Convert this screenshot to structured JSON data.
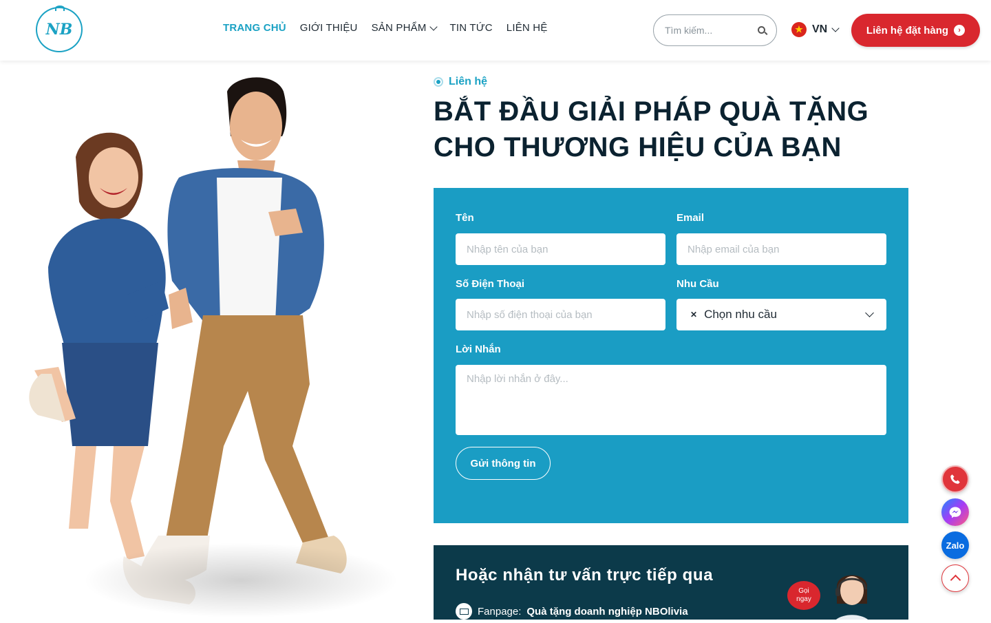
{
  "brand": {
    "logo_text": "NB"
  },
  "nav": {
    "items": [
      {
        "label": "TRANG CHỦ"
      },
      {
        "label": "GIỚI THIỆU"
      },
      {
        "label": "SẢN PHẨM"
      },
      {
        "label": "TIN TỨC"
      },
      {
        "label": "LIÊN HỆ"
      }
    ]
  },
  "search": {
    "placeholder": "Tìm kiếm..."
  },
  "lang": {
    "code": "VN"
  },
  "cta": {
    "label": "Liên hệ đặt hàng"
  },
  "section": {
    "tag": "Liên hệ",
    "heading_line1": "BẮT ĐẦU GIẢI PHÁP QUÀ TẶNG",
    "heading_line2": "CHO THƯƠNG HIỆU CỦA BẠN"
  },
  "form": {
    "name_label": "Tên",
    "name_placeholder": "Nhập tên của bạn",
    "email_label": "Email",
    "email_placeholder": "Nhập email của bạn",
    "phone_label": "Số Điện Thoại",
    "phone_placeholder": "Nhập số điện thoại của bạn",
    "need_label": "Nhu Cầu",
    "need_value": "Chọn nhu cầu",
    "message_label": "Lời Nhắn",
    "message_placeholder": "Nhập lời nhắn ở đây...",
    "submit_label": "Gửi thông tin"
  },
  "consult": {
    "title": "Hoặc nhận tư vấn trực tiếp qua",
    "fanpage_label": "Fanpage:",
    "fanpage_value": "Quà tặng doanh nghiệp NBOlivia",
    "badge_line1": "Gọi",
    "badge_line2": "ngay"
  },
  "floating": {
    "zalo_label": "Zalo"
  },
  "colors": {
    "accent": "#1ba2c4",
    "cta": "#d9272e",
    "form_bg": "#1a9dc4",
    "dark_panel": "#0c3a4a"
  }
}
